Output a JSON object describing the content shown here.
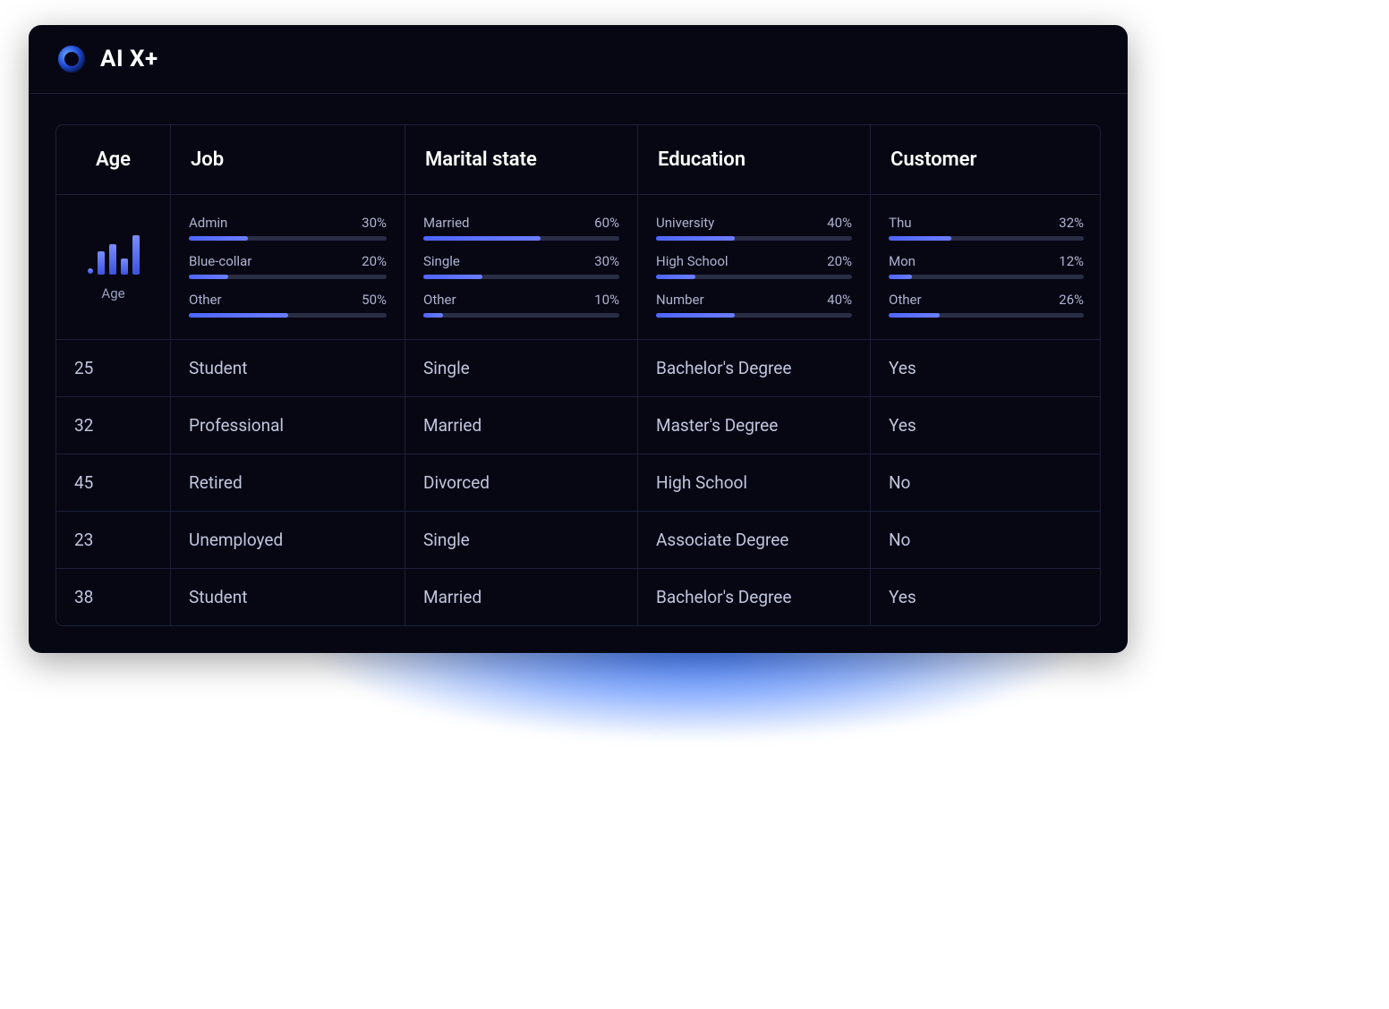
{
  "brand": "AI X+",
  "columns": {
    "age": "Age",
    "job": "Job",
    "marital": "Marital state",
    "education": "Education",
    "customer": "Customer"
  },
  "summaries": {
    "age": {
      "label": "Age"
    },
    "job": [
      {
        "label": "Admin",
        "pct": "30%",
        "value": 30
      },
      {
        "label": "Blue-collar",
        "pct": "20%",
        "value": 20
      },
      {
        "label": "Other",
        "pct": "50%",
        "value": 50
      }
    ],
    "marital": [
      {
        "label": "Married",
        "pct": "60%",
        "value": 60
      },
      {
        "label": "Single",
        "pct": "30%",
        "value": 30
      },
      {
        "label": "Other",
        "pct": "10%",
        "value": 10
      }
    ],
    "education": [
      {
        "label": "University",
        "pct": "40%",
        "value": 40
      },
      {
        "label": "High School",
        "pct": "20%",
        "value": 20
      },
      {
        "label": "Number",
        "pct": "40%",
        "value": 40
      }
    ],
    "customer": [
      {
        "label": "Thu",
        "pct": "32%",
        "value": 32
      },
      {
        "label": "Mon",
        "pct": "12%",
        "value": 12
      },
      {
        "label": "Other",
        "pct": "26%",
        "value": 26
      }
    ]
  },
  "rows": [
    {
      "age": "25",
      "job": "Student",
      "marital": "Single",
      "education": "Bachelor's Degree",
      "customer": "Yes"
    },
    {
      "age": "32",
      "job": "Professional",
      "marital": "Married",
      "education": "Master's Degree",
      "customer": "Yes"
    },
    {
      "age": "45",
      "job": "Retired",
      "marital": "Divorced",
      "education": "High School",
      "customer": "No"
    },
    {
      "age": "23",
      "job": "Unemployed",
      "marital": "Single",
      "education": "Associate Degree",
      "customer": "No"
    },
    {
      "age": "38",
      "job": "Student",
      "marital": "Married",
      "education": "Bachelor's Degree",
      "customer": "Yes"
    }
  ],
  "chart_data": [
    {
      "type": "bar",
      "title": "Job distribution",
      "categories": [
        "Admin",
        "Blue-collar",
        "Other"
      ],
      "values": [
        30,
        20,
        50
      ],
      "ylabel": "%",
      "ylim": [
        0,
        100
      ]
    },
    {
      "type": "bar",
      "title": "Marital state distribution",
      "categories": [
        "Married",
        "Single",
        "Other"
      ],
      "values": [
        60,
        30,
        10
      ],
      "ylabel": "%",
      "ylim": [
        0,
        100
      ]
    },
    {
      "type": "bar",
      "title": "Education distribution",
      "categories": [
        "University",
        "High School",
        "Number"
      ],
      "values": [
        40,
        20,
        40
      ],
      "ylabel": "%",
      "ylim": [
        0,
        100
      ]
    },
    {
      "type": "bar",
      "title": "Customer distribution",
      "categories": [
        "Thu",
        "Mon",
        "Other"
      ],
      "values": [
        32,
        12,
        26
      ],
      "ylabel": "%",
      "ylim": [
        0,
        100
      ]
    }
  ]
}
